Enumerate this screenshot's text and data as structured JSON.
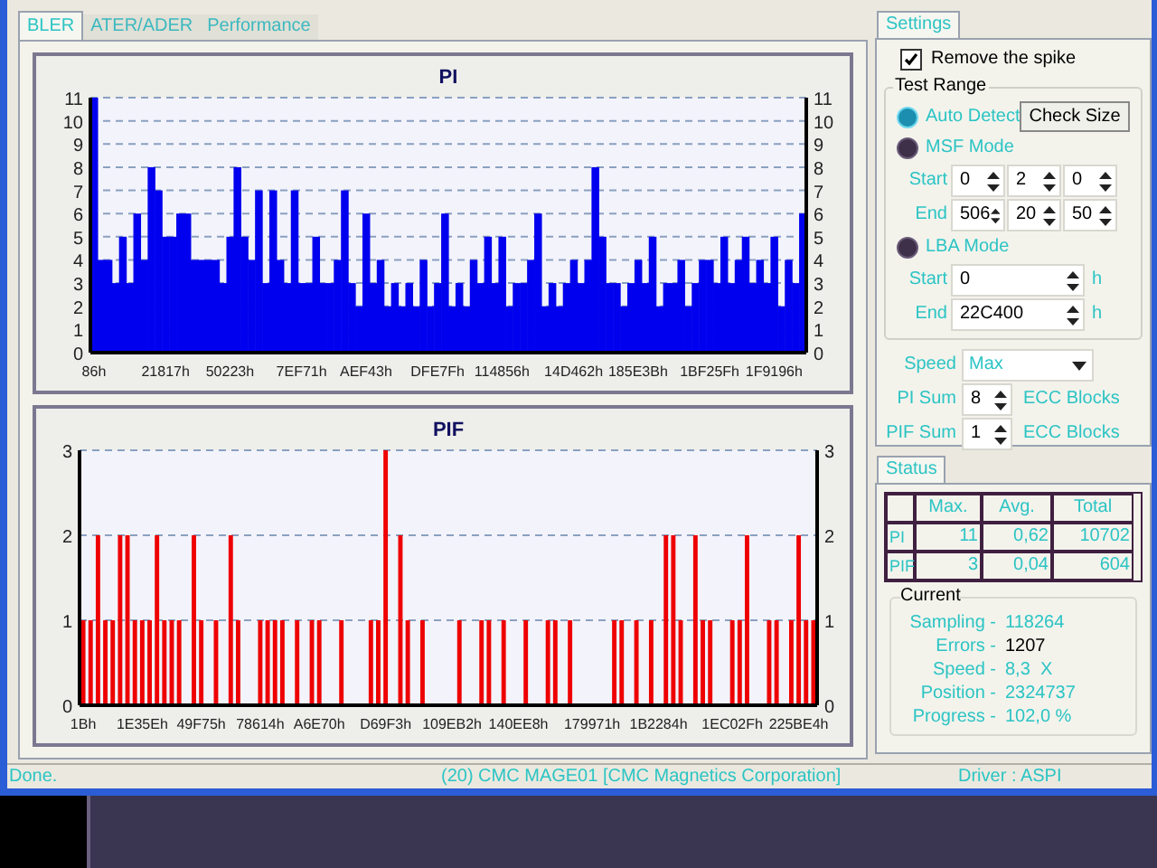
{
  "tabs": [
    {
      "label": "BLER",
      "selected": true
    },
    {
      "label": "ATER/ADER",
      "selected": false
    },
    {
      "label": "Performance",
      "selected": false
    }
  ],
  "charts": [
    {
      "left_axis_labels": [
        "11",
        "10",
        "9",
        "8",
        "7",
        "6",
        "5",
        "4",
        "3",
        "2",
        "1",
        "0"
      ],
      "right_axis_labels": [
        "11",
        "10",
        "9",
        "8",
        "7",
        "6",
        "5",
        "4",
        "3",
        "2",
        "1",
        "0"
      ],
      "chart_data": {
        "type": "bar",
        "title": "PI",
        "grid": true,
        "ylim": [
          0,
          11
        ],
        "yticks": [
          0,
          1,
          2,
          3,
          4,
          5,
          6,
          7,
          8,
          9,
          10,
          11
        ],
        "categories": [
          "86h",
          null,
          null,
          null,
          null,
          null,
          null,
          null,
          null,
          null,
          "21817h",
          null,
          null,
          null,
          null,
          null,
          null,
          null,
          null,
          "50223h",
          null,
          null,
          null,
          null,
          null,
          null,
          null,
          null,
          null,
          "7EF71h",
          null,
          null,
          null,
          null,
          null,
          null,
          null,
          null,
          "AEF43h",
          null,
          null,
          null,
          null,
          null,
          null,
          null,
          null,
          null,
          "DFE7Fh",
          null,
          null,
          null,
          null,
          null,
          null,
          null,
          null,
          "114856h",
          null,
          null,
          null,
          null,
          null,
          null,
          null,
          null,
          null,
          "14D462h",
          null,
          null,
          null,
          null,
          null,
          null,
          null,
          null,
          "185E3Bh",
          null,
          null,
          null,
          null,
          null,
          null,
          null,
          null,
          null,
          "1BF25Fh",
          null,
          null,
          null,
          null,
          null,
          null,
          null,
          null,
          "1F9196h",
          null,
          null,
          null,
          null
        ],
        "series": [
          {
            "color": "#0000ee",
            "values": [
              11,
              4,
              4,
              3,
              5,
              3,
              6,
              4,
              8,
              7,
              5,
              5,
              6,
              6,
              4,
              4,
              4,
              4,
              3,
              5,
              8,
              5,
              4,
              7,
              3,
              7,
              4,
              3,
              7,
              3,
              3,
              5,
              3,
              3,
              4,
              7,
              3,
              2,
              6,
              3,
              4,
              2,
              3,
              2,
              3,
              2,
              4,
              2,
              3,
              6,
              2,
              3,
              2,
              4,
              3,
              5,
              3,
              5,
              2,
              3,
              3,
              4,
              6,
              2,
              3,
              2,
              3,
              4,
              3,
              4,
              8,
              5,
              3,
              3,
              2,
              3,
              4,
              3,
              5,
              2,
              3,
              3,
              4,
              2,
              3,
              4,
              4,
              3,
              5,
              3,
              4,
              5,
              3,
              4,
              3,
              5,
              2,
              4,
              3,
              6
            ]
          }
        ]
      }
    },
    {
      "left_axis_labels": [
        "3",
        "2",
        "1",
        "0"
      ],
      "right_axis_labels": [
        "3",
        "2",
        "1",
        "0"
      ],
      "chart_data": {
        "type": "bar",
        "title": "PIF",
        "grid": true,
        "ylim": [
          0,
          3
        ],
        "yticks": [
          0,
          1,
          2,
          3
        ],
        "categories": [
          "1Bh",
          null,
          null,
          null,
          null,
          null,
          null,
          null,
          "1E35Eh",
          null,
          null,
          null,
          null,
          null,
          null,
          null,
          "49F75h",
          null,
          null,
          null,
          null,
          null,
          null,
          null,
          "78614h",
          null,
          null,
          null,
          null,
          null,
          null,
          null,
          "A6E70h",
          null,
          null,
          null,
          null,
          null,
          null,
          null,
          null,
          "D69F3h",
          null,
          null,
          null,
          null,
          null,
          null,
          null,
          null,
          "109EB2h",
          null,
          null,
          null,
          null,
          null,
          null,
          null,
          null,
          "140EE8h",
          null,
          null,
          null,
          null,
          null,
          null,
          null,
          null,
          null,
          "179971h",
          null,
          null,
          null,
          null,
          null,
          null,
          null,
          null,
          "1B2284h",
          null,
          null,
          null,
          null,
          null,
          null,
          null,
          null,
          null,
          "1EC02Fh",
          null,
          null,
          null,
          null,
          null,
          null,
          null,
          null,
          "225BE4h",
          null,
          null
        ],
        "series": [
          {
            "color": "#ee0000",
            "values": [
              1,
              1,
              2,
              1,
              1,
              2,
              2,
              1,
              1,
              1,
              2,
              1,
              1,
              1,
              0,
              2,
              1,
              0,
              1,
              0,
              2,
              1,
              0,
              0,
              1,
              1,
              1,
              1,
              0,
              1,
              0,
              1,
              1,
              0,
              0,
              1,
              0,
              0,
              0,
              1,
              1,
              3,
              0,
              2,
              1,
              0,
              1,
              0,
              0,
              0,
              0,
              1,
              0,
              0,
              1,
              1,
              0,
              1,
              0,
              0,
              1,
              0,
              0,
              1,
              1,
              0,
              1,
              0,
              0,
              0,
              0,
              0,
              1,
              1,
              0,
              1,
              0,
              1,
              0,
              2,
              2,
              1,
              0,
              2,
              1,
              1,
              0,
              0,
              1,
              1,
              2,
              0,
              0,
              1,
              1,
              0,
              1,
              2,
              1,
              1
            ]
          }
        ]
      }
    }
  ],
  "settings": {
    "tab": "Settings",
    "remove_spike": {
      "label": "Remove the spike",
      "checked": true
    },
    "test_range": {
      "title": "Test Range",
      "auto": {
        "label": "Auto Detect",
        "selected": true,
        "button": "Check Size"
      },
      "msf": {
        "label": "MSF Mode",
        "selected": false,
        "rows": [
          {
            "label": "Start",
            "values": [
              "0",
              "2",
              "0"
            ]
          },
          {
            "label": "End",
            "values": [
              "506",
              "20",
              "50"
            ]
          }
        ]
      },
      "lba": {
        "label": "LBA Mode",
        "selected": false,
        "rows": [
          {
            "label": "Start",
            "value": "0",
            "unit": "h"
          },
          {
            "label": "End",
            "value": "22C400",
            "unit": "h"
          }
        ]
      }
    },
    "speed": {
      "label": "Speed",
      "value": "Max"
    },
    "sums": [
      {
        "label": "PI Sum",
        "value": "8",
        "unit": "ECC Blocks"
      },
      {
        "label": "PIF Sum",
        "value": "1",
        "unit": "ECC Blocks"
      }
    ]
  },
  "status": {
    "tab": "Status",
    "columns": [
      "Max.",
      "Avg.",
      "Total"
    ],
    "rows": [
      {
        "name": "PI",
        "cells": [
          "11",
          "0,62",
          "10702"
        ]
      },
      {
        "name": "PIF",
        "cells": [
          "3",
          "0,04",
          "604"
        ]
      }
    ],
    "current": {
      "title": "Current",
      "items": [
        {
          "label": "Sampling -",
          "value": "118264",
          "alert": false
        },
        {
          "label": "Errors -",
          "value": "1207",
          "alert": true
        },
        {
          "label": "Speed -",
          "value": "8,3  X",
          "alert": false
        },
        {
          "label": "Position -",
          "value": "2324737",
          "alert": false
        },
        {
          "label": "Progress -",
          "value": "102,0 %",
          "alert": false
        }
      ]
    }
  },
  "status_bar": [
    "Done.",
    "(20) CMC MAGE01 [CMC Magnetics Corporation]",
    "Driver : ASPI"
  ]
}
